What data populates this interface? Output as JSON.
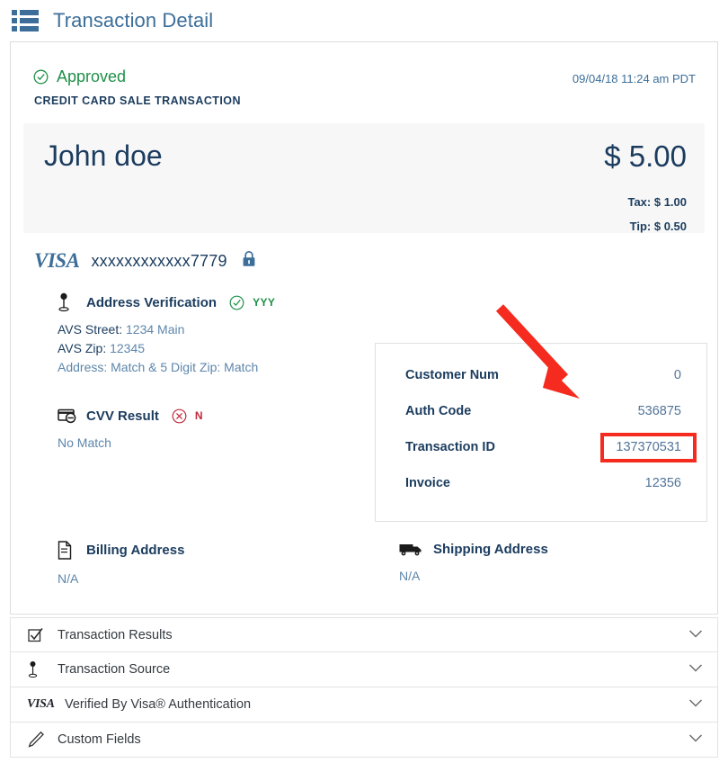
{
  "header": {
    "title": "Transaction Detail",
    "icon": "grid-menu-icon"
  },
  "transaction": {
    "status": "Approved",
    "status_icon": "circle-check-icon",
    "status_color": "#1f9048",
    "timestamp": "09/04/18 11:24 am PDT",
    "type": "CREDIT CARD SALE TRANSACTION",
    "customer_name": "John doe",
    "amount": "$ 5.00",
    "tax": "Tax: $ 1.00",
    "tip": "Tip: $ 0.50",
    "card_brand": "VISA",
    "card_number": "xxxxxxxxxxxx7779",
    "lock_icon": "lock-icon"
  },
  "address_verification": {
    "title": "Address Verification",
    "icon": "map-pin-icon",
    "result_icon": "circle-check-icon",
    "result_code": "YYY",
    "avs_street_label": "AVS Street:",
    "avs_street_value": "1234 Main",
    "avs_zip_label": "AVS Zip:",
    "avs_zip_value": "12345",
    "address_summary": "Address: Match & 5 Digit Zip: Match"
  },
  "cvv_result": {
    "title": "CVV Result",
    "icon": "credit-card-icon",
    "result_icon": "circle-x-icon",
    "result_code": "N",
    "detail": "No Match"
  },
  "billing_address": {
    "title": "Billing Address",
    "icon": "document-icon",
    "value": "N/A"
  },
  "shipping_address": {
    "title": "Shipping Address",
    "icon": "truck-icon",
    "value": "N/A"
  },
  "detail_box": {
    "rows": [
      {
        "label": "Customer Num",
        "value": "0",
        "highlighted": false
      },
      {
        "label": "Auth Code",
        "value": "536875",
        "highlighted": false
      },
      {
        "label": "Transaction ID",
        "value": "137370531",
        "highlighted": true
      },
      {
        "label": "Invoice",
        "value": "12356",
        "highlighted": false
      }
    ],
    "highlight_color": "#f42b1e"
  },
  "annotation": {
    "arrow_color": "#f42b1e",
    "points_to": "Transaction ID"
  },
  "accordion": {
    "items": [
      {
        "label": "Transaction Results",
        "icon": "checkbox-checked-icon"
      },
      {
        "label": "Transaction Source",
        "icon": "map-pin-icon"
      },
      {
        "label": "Verified By Visa® Authentication",
        "icon": "visa-logo-icon",
        "visa_text": "VISA"
      },
      {
        "label": "Custom Fields",
        "icon": "pencil-icon"
      }
    ],
    "chevron_icon": "chevron-down-icon"
  }
}
